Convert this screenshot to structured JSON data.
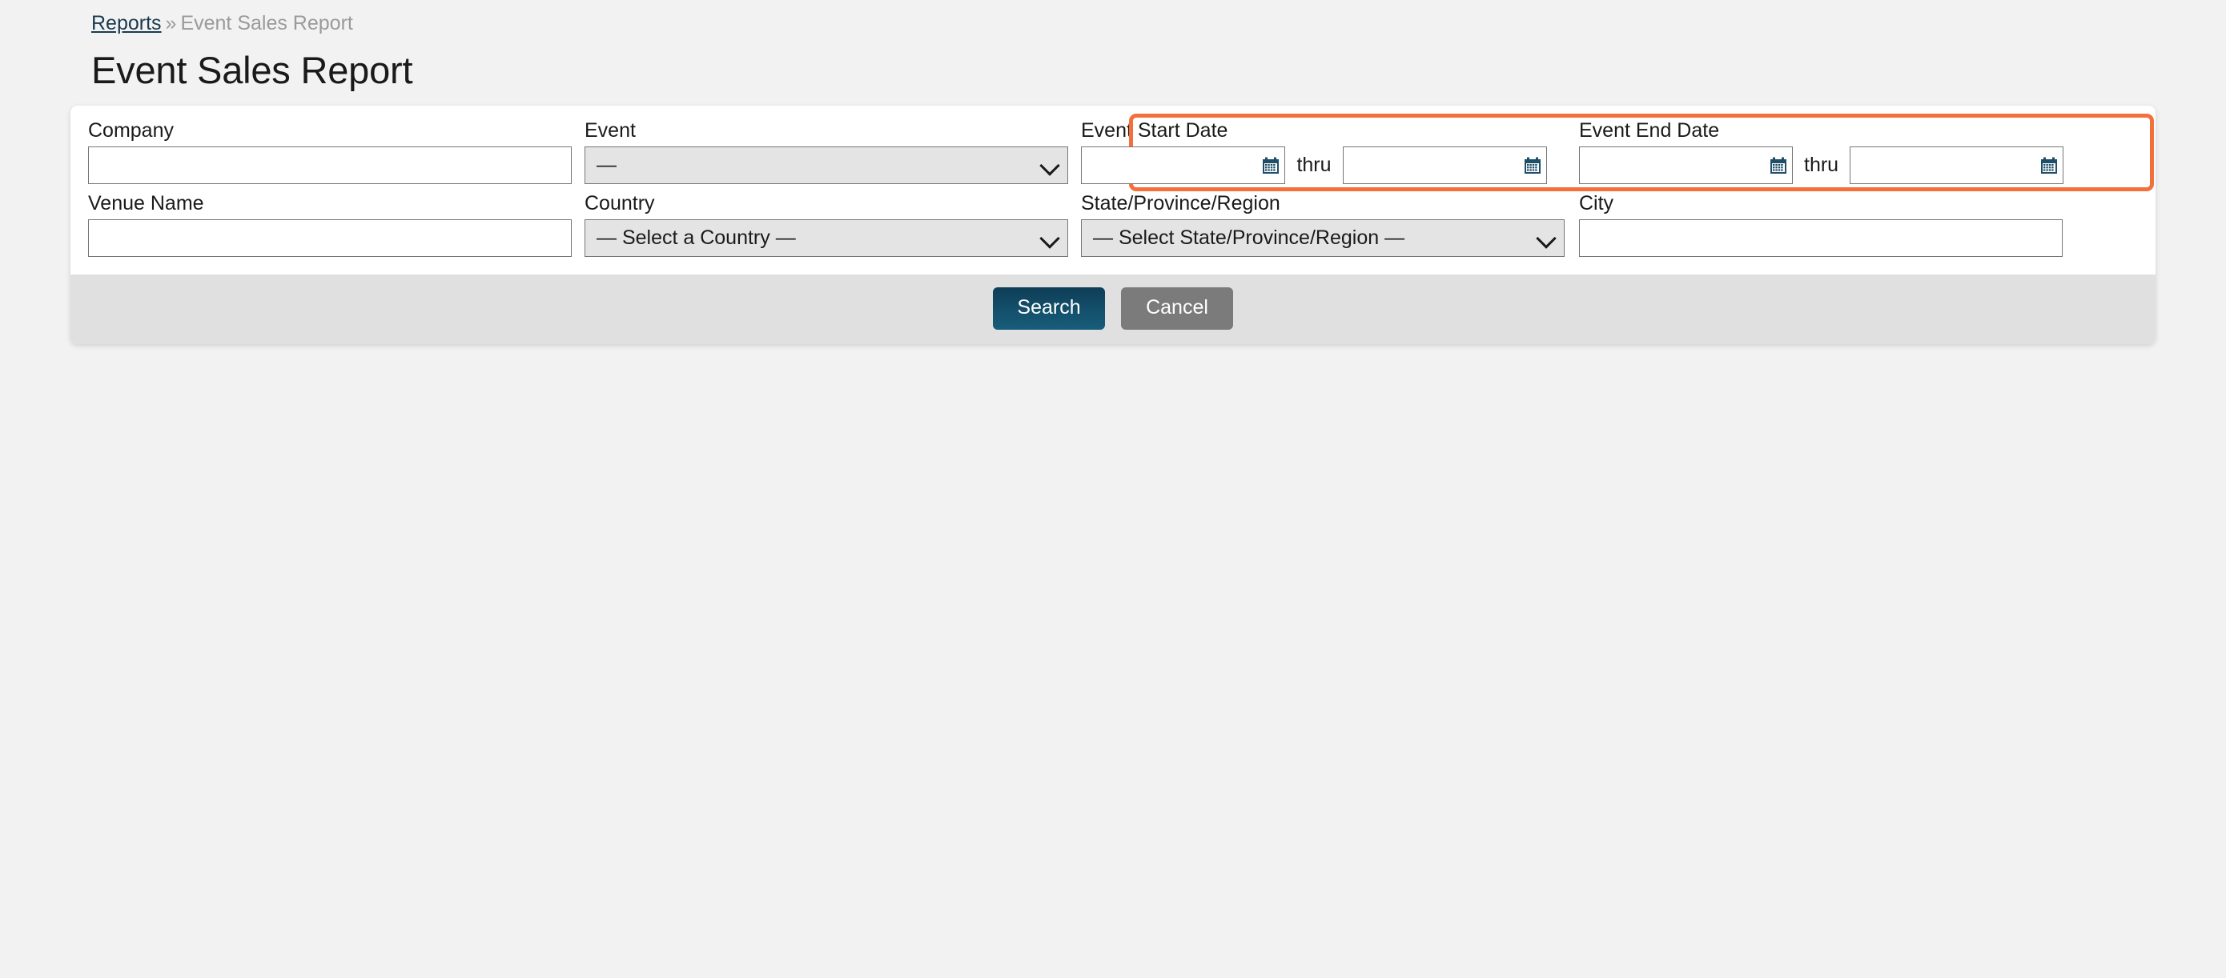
{
  "breadcrumb": {
    "link_label": "Reports",
    "separator": "»",
    "current": "Event Sales Report"
  },
  "page": {
    "title": "Event Sales Report"
  },
  "colors": {
    "page_background": "#f2f2f2",
    "card_background": "#ffffff",
    "footer_background": "#e0e0e0",
    "highlight_border": "#f2703c",
    "primary_button": "#14506c",
    "secondary_button": "#7b7b7b",
    "calendar_icon": "#1f4e68",
    "link": "#1b3a4f",
    "muted_text": "#9a9a9a"
  },
  "form": {
    "company": {
      "label": "Company",
      "value": "",
      "placeholder": ""
    },
    "event": {
      "label": "Event",
      "selected": "—",
      "icon": "chevron-down-icon"
    },
    "event_start_date": {
      "label": "Event Start Date",
      "from_value": "",
      "from_placeholder": "",
      "thru_label": "thru",
      "to_value": "",
      "to_placeholder": "",
      "icon": "calendar-icon",
      "highlighted": true
    },
    "event_end_date": {
      "label": "Event End Date",
      "from_value": "",
      "from_placeholder": "",
      "thru_label": "thru",
      "to_value": "",
      "to_placeholder": "",
      "icon": "calendar-icon",
      "highlighted": true
    },
    "venue_name": {
      "label": "Venue Name",
      "value": "",
      "placeholder": ""
    },
    "country": {
      "label": "Country",
      "selected": "— Select a Country —",
      "icon": "chevron-down-icon"
    },
    "state_province_region": {
      "label": "State/Province/Region",
      "selected": "— Select State/Province/Region —",
      "icon": "chevron-down-icon"
    },
    "city": {
      "label": "City",
      "value": "",
      "placeholder": ""
    }
  },
  "actions": {
    "search_label": "Search",
    "cancel_label": "Cancel"
  }
}
